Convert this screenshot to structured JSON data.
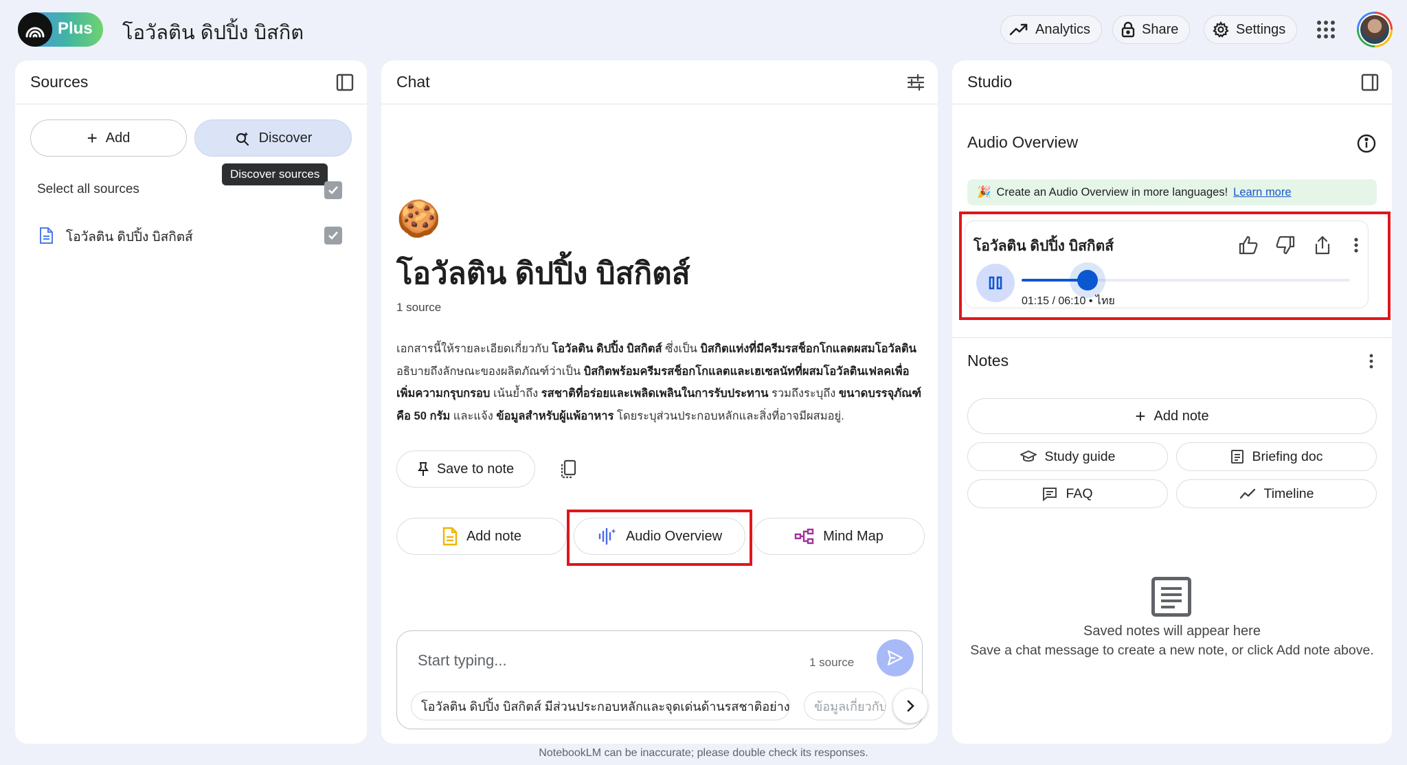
{
  "header": {
    "plan_label": "Plus",
    "notebook_title": "โอวัลติน ดิปปิ้ง บิสกิต",
    "analytics_label": "Analytics",
    "share_label": "Share",
    "settings_label": "Settings"
  },
  "sources": {
    "title": "Sources",
    "add_label": "Add",
    "discover_label": "Discover",
    "discover_tooltip": "Discover sources",
    "select_all_label": "Select all sources",
    "items": [
      {
        "name": "โอวัลติน ดิปปิ้ง บิสกิตส์",
        "checked": true
      }
    ]
  },
  "chat": {
    "title": "Chat",
    "emoji": "🍪",
    "notebook_heading": "โอวัลติน ดิปปิ้ง บิสกิตส์",
    "source_count": "1 source",
    "summary_segments": [
      {
        "text": "เอกสารนี้ให้รายละเอียดเกี่ยวกับ ",
        "bold": false
      },
      {
        "text": "โอวัลติน ดิปปิ้ง บิสกิตส์",
        "bold": true
      },
      {
        "text": " ซึ่งเป็น ",
        "bold": false
      },
      {
        "text": "บิสกิตแท่งที่มีครีมรสช็อกโกแลตผสมโอวัลติน",
        "bold": true
      },
      {
        "text": " อธิบายถึงลักษณะของผลิตภัณฑ์ว่าเป็น ",
        "bold": false
      },
      {
        "text": "บิสกิตพร้อมครีมรสช็อกโกแลตและเฮเซลนัทที่ผสมโอวัลตินเฟลคเพื่อเพิ่มความกรุบกรอบ",
        "bold": true
      },
      {
        "text": " เน้นย้ำถึง ",
        "bold": false
      },
      {
        "text": "รสชาติที่อร่อยและเพลิดเพลินในการรับประทาน",
        "bold": true
      },
      {
        "text": " รวมถึงระบุถึง ",
        "bold": false
      },
      {
        "text": "ขนาดบรรจุภัณฑ์คือ 50 กรัม",
        "bold": true
      },
      {
        "text": " และแจ้ง ",
        "bold": false
      },
      {
        "text": "ข้อมูลสำหรับผู้แพ้อาหาร",
        "bold": true
      },
      {
        "text": " โดยระบุส่วนประกอบหลักและสิ่งที่อาจมีผสมอยู่.",
        "bold": false
      }
    ],
    "save_to_note_label": "Save to note",
    "add_note_label": "Add note",
    "audio_overview_label": "Audio Overview",
    "mind_map_label": "Mind Map",
    "composer": {
      "placeholder": "Start typing...",
      "source_count": "1 source",
      "suggestions": [
        "โอวัลติน ดิปปิ้ง บิสกิตส์ มีส่วนประกอบหลักและจุดเด่นด้านรสชาติอย่างไร",
        "ข้อมูลเกี่ยวกับ"
      ]
    },
    "disclaimer": "NotebookLM can be inaccurate; please double check its responses."
  },
  "studio": {
    "title": "Studio",
    "audio_overview_heading": "Audio Overview",
    "banner_emoji": "🎉",
    "banner_text": "Create an Audio Overview in more languages!",
    "banner_link": "Learn more",
    "player": {
      "title": "โอวัลติน ดิปปิ้ง บิสกิตส์",
      "time": "01:15 / 06:10 • ไทย",
      "progress": 0.2
    },
    "notes_title": "Notes",
    "add_note_label": "Add note",
    "study_guide_label": "Study guide",
    "briefing_doc_label": "Briefing doc",
    "faq_label": "FAQ",
    "timeline_label": "Timeline",
    "empty_title": "Saved notes will appear here",
    "empty_subtitle": "Save a chat message to create a new note, or click Add note above."
  },
  "colors": {
    "accent": "#0b57d0",
    "highlight_box": "#e0161b",
    "background": "#eef1f9"
  }
}
